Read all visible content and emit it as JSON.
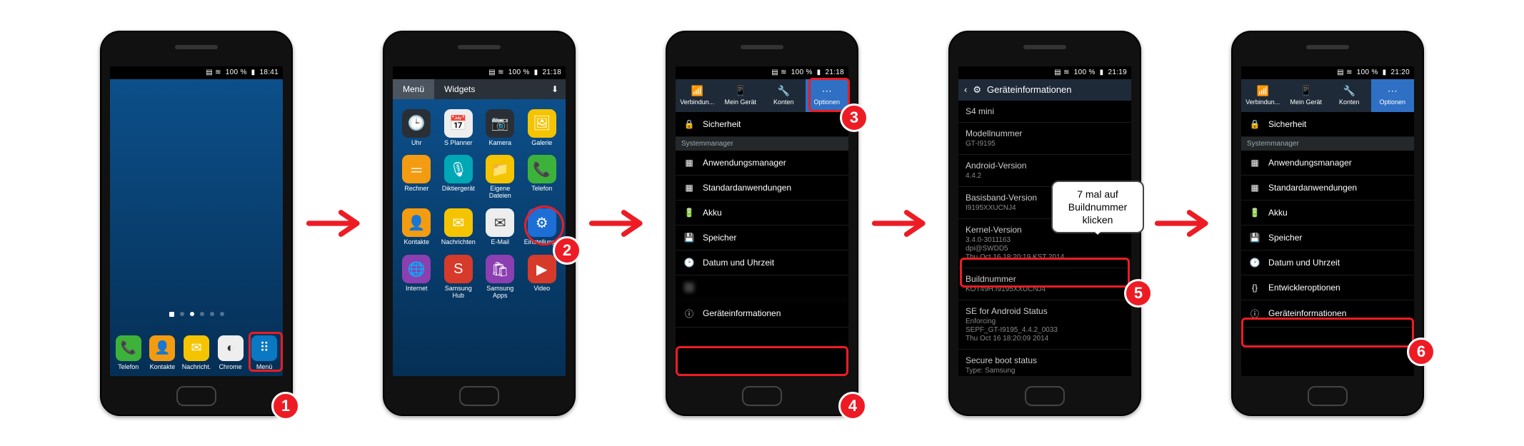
{
  "arrow_color": "#ed1c24",
  "phones": {
    "p1": {
      "status": {
        "signal": "▤",
        "pct": "100 %",
        "time": "18:41"
      },
      "dock": [
        {
          "icon": "📞",
          "label": "Telefon",
          "cls": "bg-green"
        },
        {
          "icon": "👤",
          "label": "Kontakte",
          "cls": "bg-orange"
        },
        {
          "icon": "✉",
          "label": "Nachricht.",
          "cls": "bg-y"
        },
        {
          "icon": "◐",
          "label": "Chrome",
          "cls": "bg-white"
        },
        {
          "icon": "⠿",
          "label": "Menü",
          "cls": "bg-grid"
        }
      ],
      "badge": "1"
    },
    "p2": {
      "status": {
        "pct": "100 %",
        "time": "21:18"
      },
      "tabs": {
        "menu": "Menü",
        "widgets": "Widgets"
      },
      "apps": [
        {
          "icon": "🕒",
          "label": "Uhr",
          "cls": "bg-dark"
        },
        {
          "icon": "📅",
          "label": "S Planner",
          "cls": "bg-white"
        },
        {
          "icon": "📷",
          "label": "Kamera",
          "cls": "bg-dark"
        },
        {
          "icon": "🖼",
          "label": "Galerie",
          "cls": "bg-y"
        },
        {
          "icon": "＝",
          "label": "Rechner",
          "cls": "bg-orange"
        },
        {
          "icon": "🎙",
          "label": "Diktiergerät",
          "cls": "bg-teal"
        },
        {
          "icon": "📁",
          "label": "Eigene Dateien",
          "cls": "bg-y"
        },
        {
          "icon": "📞",
          "label": "Telefon",
          "cls": "bg-green"
        },
        {
          "icon": "👤",
          "label": "Kontakte",
          "cls": "bg-orange"
        },
        {
          "icon": "✉",
          "label": "Nachrichten",
          "cls": "bg-y"
        },
        {
          "icon": "✉",
          "label": "E-Mail",
          "cls": "bg-white"
        },
        {
          "icon": "⚙",
          "label": "Einstellungen",
          "cls": "bg-blue"
        },
        {
          "icon": "🌐",
          "label": "Internet",
          "cls": "bg-purple"
        },
        {
          "icon": "S",
          "label": "Samsung Hub",
          "cls": "bg-red"
        },
        {
          "icon": "🛍",
          "label": "Samsung Apps",
          "cls": "bg-purple"
        },
        {
          "icon": "▶",
          "label": "Video",
          "cls": "bg-red"
        }
      ],
      "badge": "2"
    },
    "p3": {
      "status": {
        "pct": "100 %",
        "time": "21:18"
      },
      "tabs": [
        {
          "icon": "📶",
          "label": "Verbindun..."
        },
        {
          "icon": "📱",
          "label": "Mein Gerät"
        },
        {
          "icon": "🔧",
          "label": "Konten"
        },
        {
          "icon": "⋯",
          "label": "Optionen"
        }
      ],
      "rows": [
        {
          "icon": "🔒",
          "label": "Sicherheit",
          "i": 0
        },
        {
          "type": "sect",
          "label": "Systemmanager"
        },
        {
          "icon": "▦",
          "label": "Anwendungsmanager",
          "i": 1
        },
        {
          "icon": "▦",
          "label": "Standardanwendungen",
          "i": 2
        },
        {
          "icon": "🔋",
          "label": "Akku",
          "i": 3
        },
        {
          "icon": "💾",
          "label": "Speicher",
          "i": 4
        },
        {
          "icon": "🕑",
          "label": "Datum und Uhrzeit",
          "i": 5
        },
        {
          "icon": "⬛",
          "label": "",
          "i": 6,
          "blur": true
        },
        {
          "icon": "ⓘ",
          "label": "Geräteinformationen",
          "i": 7
        }
      ],
      "badge3": "3",
      "badge4": "4"
    },
    "p4": {
      "status": {
        "pct": "100 %",
        "time": "21:19"
      },
      "title": "Geräteinformationen",
      "subtitle": "S4 mini",
      "items": [
        {
          "k": "Modellnummer",
          "v": "GT-I9195"
        },
        {
          "k": "Android-Version",
          "v": "4.4.2"
        },
        {
          "k": "Basisband-Version",
          "v": "I9195XXUCNJ4"
        },
        {
          "k": "Kernel-Version",
          "v": "3.4.0-3011163\ndpi@SWDD5\nThu Oct 16 18:20:19 KST 2014"
        },
        {
          "k": "Buildnummer",
          "v": "KOT49H.I9195XXUCNJ4"
        },
        {
          "k": "SE for Android Status",
          "v": "Enforcing\nSEPF_GT-I9195_4.4.2_0033\nThu Oct 16 18:20:09 2014"
        },
        {
          "k": "Secure boot status",
          "v": "Type: Samsung"
        }
      ],
      "speech": "7 mal auf Buildnummer klicken",
      "badge": "5"
    },
    "p6": {
      "status": {
        "pct": "100 %",
        "time": "21:20"
      },
      "tabs": [
        {
          "icon": "📶",
          "label": "Verbindun..."
        },
        {
          "icon": "📱",
          "label": "Mein Gerät"
        },
        {
          "icon": "🔧",
          "label": "Konten"
        },
        {
          "icon": "⋯",
          "label": "Optionen"
        }
      ],
      "rows": [
        {
          "icon": "🔒",
          "label": "Sicherheit",
          "i": 0
        },
        {
          "type": "sect",
          "label": "Systemmanager"
        },
        {
          "icon": "▦",
          "label": "Anwendungsmanager",
          "i": 1
        },
        {
          "icon": "▦",
          "label": "Standardanwendungen",
          "i": 2
        },
        {
          "icon": "🔋",
          "label": "Akku",
          "i": 3
        },
        {
          "icon": "💾",
          "label": "Speicher",
          "i": 4
        },
        {
          "icon": "🕑",
          "label": "Datum und Uhrzeit",
          "i": 5
        },
        {
          "icon": "{}",
          "label": "Entwickleroptionen",
          "i": 6
        },
        {
          "icon": "ⓘ",
          "label": "Geräteinformationen",
          "i": 7
        }
      ],
      "badge": "6"
    }
  }
}
